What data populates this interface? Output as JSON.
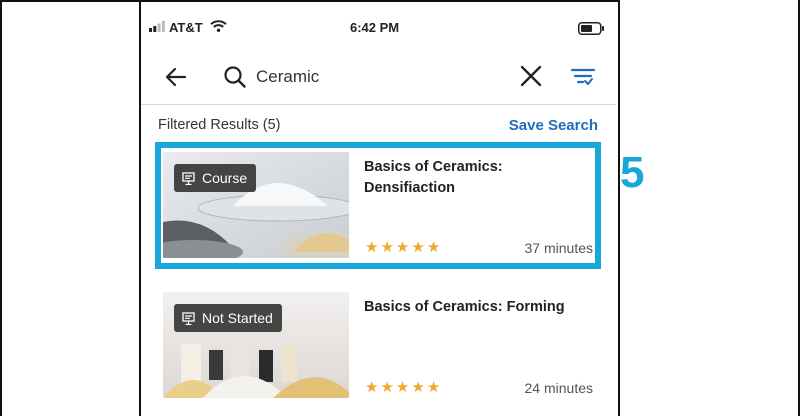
{
  "status_bar": {
    "carrier": "AT&T",
    "time": "6:42 PM"
  },
  "search": {
    "query": "Ceramic",
    "placeholder": "Search"
  },
  "results": {
    "summary": "Filtered Results (5)",
    "save_search_label": "Save Search"
  },
  "cards": [
    {
      "badge": "Course",
      "title": "Basics of Ceramics: Densifiaction",
      "rating": 5,
      "duration": "37 minutes",
      "selected": true
    },
    {
      "badge": "Not Started",
      "title": "Basics of Ceramics: Forming",
      "rating": 5,
      "duration": "24 minutes",
      "selected": false
    }
  ],
  "annotation": {
    "step_number": "5"
  },
  "colors": {
    "accent": "#1f6ebd",
    "highlight": "#19a6d8",
    "star": "#f0a82b",
    "badge_bg": "#2d2d2d"
  },
  "icons": [
    "signal-icon",
    "wifi-icon",
    "battery-icon",
    "back-arrow-icon",
    "search-icon",
    "close-icon",
    "filter-icon",
    "course-icon",
    "star-icon"
  ]
}
